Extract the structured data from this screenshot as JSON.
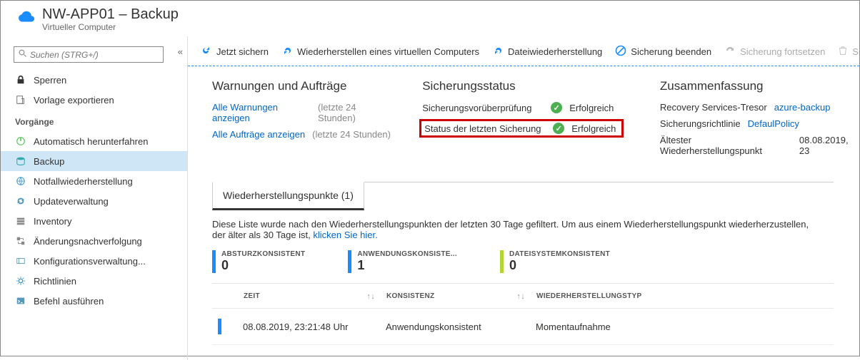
{
  "header": {
    "title": "NW-APP01 – Backup",
    "subtitle": "Virtueller Computer"
  },
  "search": {
    "placeholder": "Suchen (STRG+/)"
  },
  "sidebar": {
    "lock": "Sperren",
    "export": "Vorlage exportieren",
    "section": "Vorgänge",
    "items": {
      "auto_shutdown": "Automatisch herunterfahren",
      "backup": "Backup",
      "dr": "Notfallwiederherstellung",
      "update": "Updateverwaltung",
      "inventory": "Inventory",
      "change": "Änderungsnachverfolgung",
      "config": "Konfigurationsverwaltung...",
      "policies": "Richtlinien",
      "runcmd": "Befehl ausführen"
    }
  },
  "toolbar": {
    "backup_now": "Jetzt sichern",
    "restore_vm": "Wiederherstellen eines virtuellen Computers",
    "file_recovery": "Dateiwiederherstellung",
    "stop_backup": "Sicherung beenden",
    "resume": "Sicherung fortsetzen",
    "delete": "Si"
  },
  "alerts": {
    "heading": "Warnungen und Aufträge",
    "all_alerts": "Alle Warnungen anzeigen",
    "all_jobs": "Alle Aufträge anzeigen",
    "window": "(letzte 24 Stunden)"
  },
  "status": {
    "heading": "Sicherungsstatus",
    "precheck_label": "Sicherungsvorüberprüfung",
    "precheck_value": "Erfolgreich",
    "last_label": "Status der letzten Sicherung",
    "last_value": "Erfolgreich"
  },
  "summary": {
    "heading": "Zusammenfassung",
    "vault_label": "Recovery Services-Tresor",
    "vault_value": "azure-backup",
    "policy_label": "Sicherungsrichtlinie",
    "policy_value": "DefaulPolicy",
    "oldest_label": "Ältester Wiederherstellungspunkt",
    "oldest_value": "08.08.2019, 23"
  },
  "restore_points": {
    "tab": "Wiederherstellungspunkte (1)",
    "desc1": "Diese Liste wurde nach den Wiederherstellungspunkten der letzten 30 Tage gefiltert. Um aus einem Wiederherstellungspunkt wiederherzustellen, der älter als 30 Tage ist, ",
    "desc_link": "klicken Sie hier.",
    "crash": {
      "label": "ABSTURZKONSISTENT",
      "value": "0"
    },
    "app": {
      "label": "ANWENDUNGSKONSISTE...",
      "value": "1"
    },
    "fs": {
      "label": "DATEISYSTEMKONSISTENT",
      "value": "0"
    },
    "columns": {
      "time": "ZEIT",
      "consistency": "KONSISTENZ",
      "type": "WIEDERHERSTELLUNGSTYP"
    },
    "row": {
      "time": "08.08.2019, 23:21:48 Uhr",
      "consistency": "Anwendungskonsistent",
      "type": "Momentaufnahme"
    }
  }
}
